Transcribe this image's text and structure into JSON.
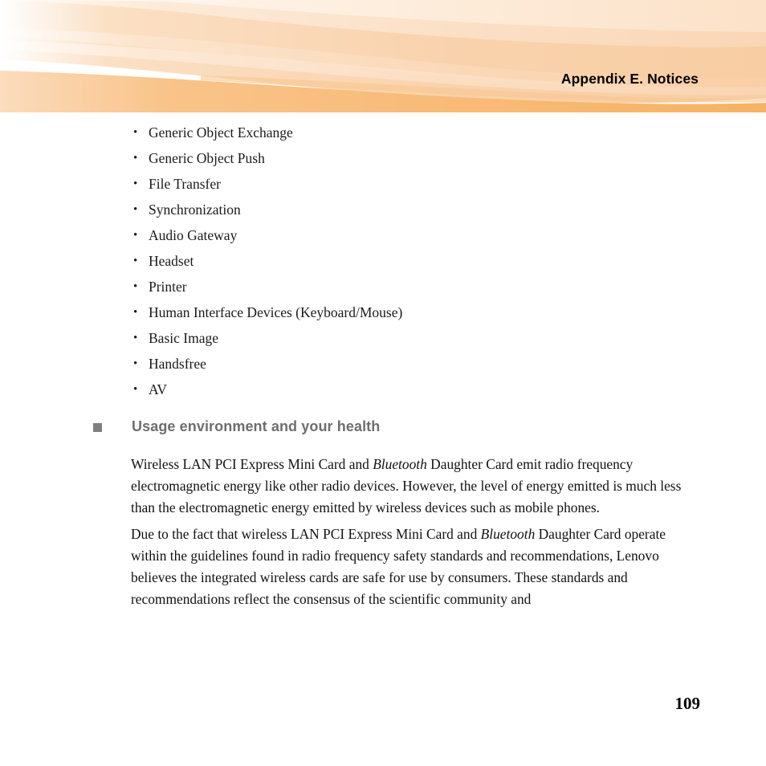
{
  "header": {
    "title": "Appendix E. Notices",
    "banner_colors": {
      "band_light": "#FDEAD6",
      "band_mid": "#FBDCBE",
      "band_peach": "#F9D2AC",
      "band_orange": "#F7B263",
      "band_pale": "#FEF4EA"
    }
  },
  "bullet_list": {
    "items": [
      "Generic Object Exchange",
      "Generic Object Push",
      "File Transfer",
      "Synchronization",
      "Audio Gateway",
      "Headset",
      "Printer",
      "Human Interface Devices (Keyboard/Mouse)",
      "Basic Image",
      "Handsfree",
      "AV"
    ]
  },
  "section": {
    "heading": "Usage environment and your health",
    "heading_color": "#6E6E6E",
    "marker_color": "#808080",
    "paragraphs": [
      {
        "runs": [
          {
            "text": "Wireless LAN PCI Express Mini Card and ",
            "style": "normal"
          },
          {
            "text": "Bluetooth",
            "style": "italic"
          },
          {
            "text": " Daughter Card emit radio frequency electromagnetic energy like other radio devices. However, the level of energy emitted is much less than the electromagnetic energy emitted by wireless devices such as mobile phones.",
            "style": "normal"
          }
        ]
      },
      {
        "runs": [
          {
            "text": "Due to the fact that wireless LAN PCI Express Mini Card and ",
            "style": "normal"
          },
          {
            "text": "Bluetooth",
            "style": "italic"
          },
          {
            "text": " Daughter Card operate within the guidelines found in radio frequency safety standards and recommendations, Lenovo believes the integrated wireless cards are safe for use by consumers. These standards and recommendations reflect the consensus of the scientific community and",
            "style": "normal"
          }
        ]
      }
    ]
  },
  "footer": {
    "page_number": "109"
  }
}
